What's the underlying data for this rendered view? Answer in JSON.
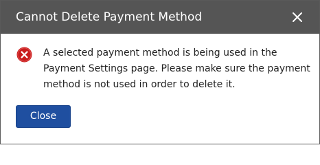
{
  "dialog": {
    "title": "Cannot Delete Payment Method",
    "close_icon": "close-icon",
    "error_icon": "error-circle-x-icon",
    "message": "A selected payment method is being used in the Payment Settings page. Please make sure the payment method is not used in order to delete it.",
    "close_button_label": "Close"
  },
  "colors": {
    "titlebar_bg": "#555555",
    "title_text": "#ffffff",
    "error_icon": "#c91c1c",
    "primary_button": "#1f4fa0"
  }
}
